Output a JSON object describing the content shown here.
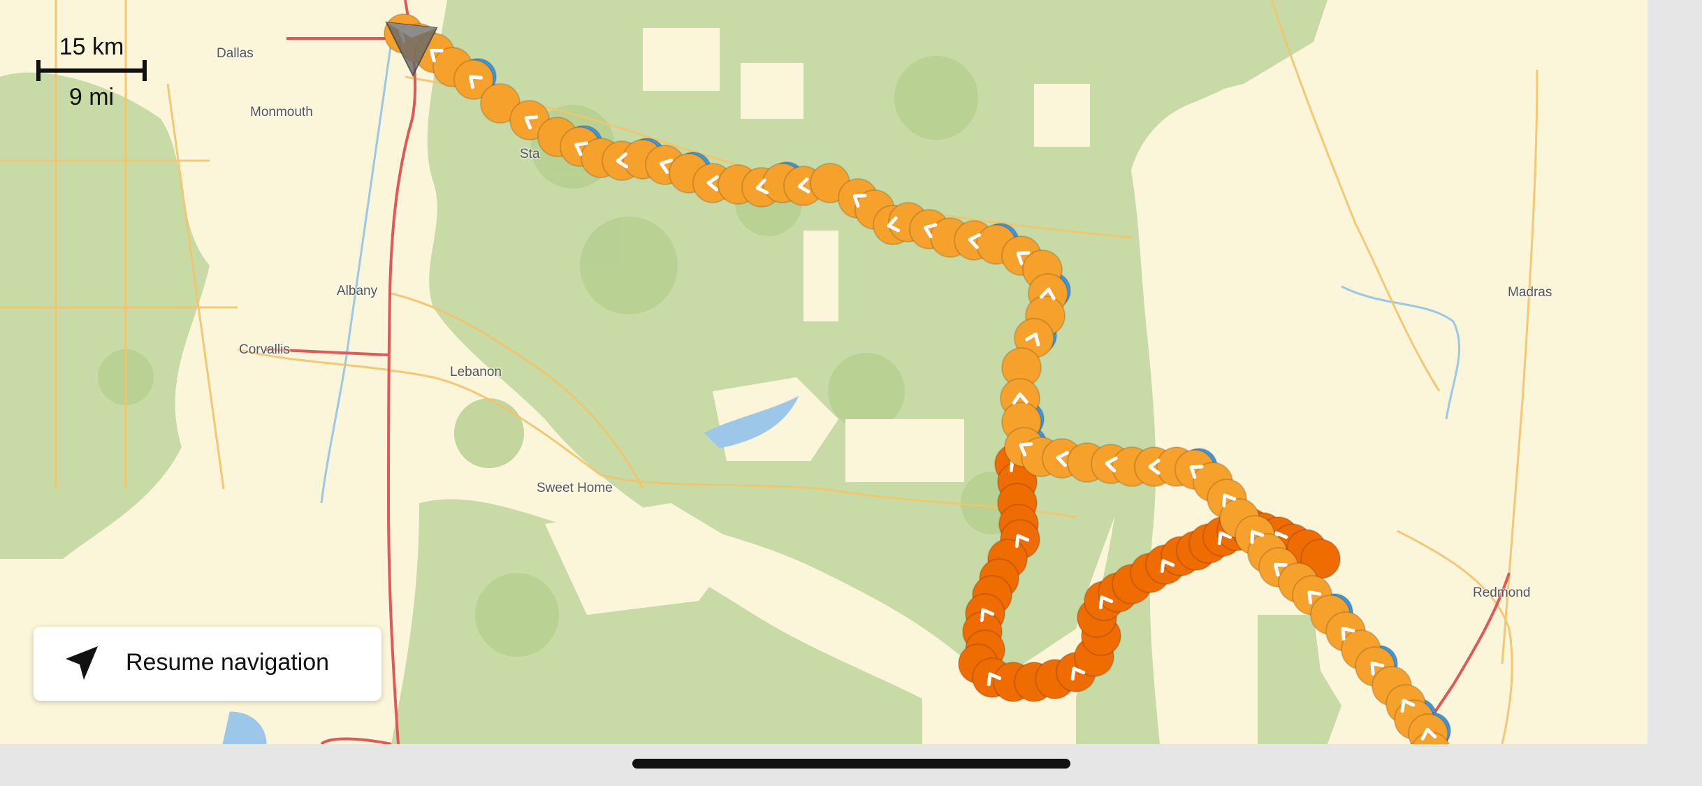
{
  "scale": {
    "metric_label": "15 km",
    "imperial_label": "9 mi"
  },
  "places": [
    {
      "name": "Dallas"
    },
    {
      "name": "Monmouth"
    },
    {
      "name": "Albany"
    },
    {
      "name": "Corvallis"
    },
    {
      "name": "Lebanon"
    },
    {
      "name": "Sweet Home"
    },
    {
      "name": "Madras"
    },
    {
      "name": "Redmond"
    },
    {
      "name": "Sta"
    }
  ],
  "resume": {
    "label": "Resume navigation",
    "icon": "navigation-arrow-icon"
  },
  "route": {
    "marker_colors": {
      "orange_marker": "#f5a12c",
      "dark_orange_marker": "#ef6c00",
      "blue_marker": "#3b98e0",
      "chevron": "#ffffff"
    },
    "track_icon": "chevron-left-icon",
    "position_icon": "location-cone-icon"
  },
  "map_colors": {
    "background": "#fbf6d9",
    "forest": "#c8dba6",
    "dark_forest": "#b5ce8f",
    "highway": "#e05858",
    "road": "#f2c46a",
    "water": "#9cc7e8"
  }
}
